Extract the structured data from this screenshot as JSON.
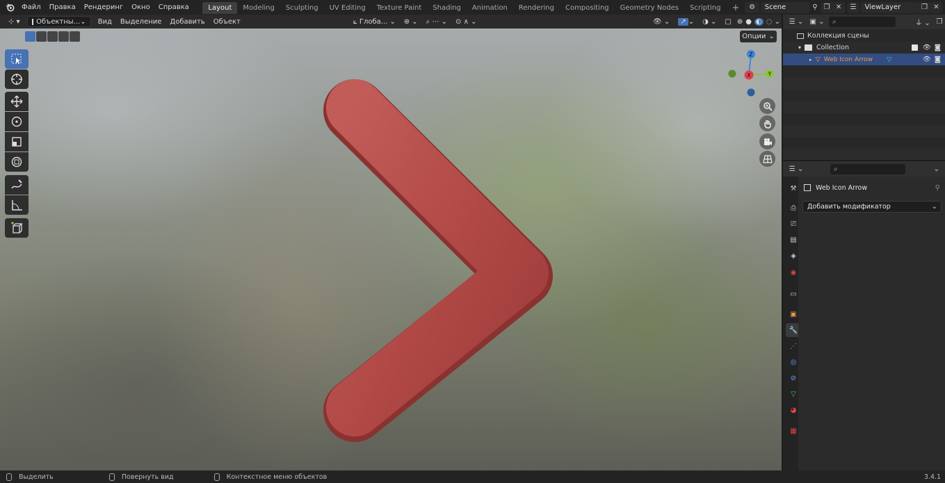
{
  "app": {
    "logo": "blender-logo-icon",
    "version": "3.4.1"
  },
  "menu": [
    "Файл",
    "Правка",
    "Рендеринг",
    "Окно",
    "Справка"
  ],
  "workspaces": [
    "Layout",
    "Modeling",
    "Sculpting",
    "UV Editing",
    "Texture Paint",
    "Shading",
    "Animation",
    "Rendering",
    "Compositing",
    "Geometry Nodes",
    "Scripting"
  ],
  "active_workspace": "Layout",
  "add_workspace": "+",
  "scene": {
    "name": "Scene",
    "view_layer": "ViewLayer"
  },
  "viewport_header": {
    "mode": "Объектны...",
    "menus": [
      "Вид",
      "Выделение",
      "Добавить",
      "Объект"
    ],
    "transform_orientation": "Глоба...",
    "options": "Опции"
  },
  "gizmo": {
    "axes": [
      "X",
      "Y",
      "Z"
    ]
  },
  "toolbar": [
    "select-box-icon",
    "cursor-icon",
    "move-icon",
    "rotate-icon",
    "scale-icon",
    "transform-icon",
    "annotate-icon",
    "measure-icon",
    "add-cube-icon"
  ],
  "navigation": [
    "zoom-icon",
    "pan-hand-icon",
    "camera-icon",
    "grid-perspective-icon"
  ],
  "object": {
    "shape": "chevron-right",
    "color": "#b24a47"
  },
  "outliner": {
    "scene_collection": "Коллекция сцены",
    "collection": "Collection",
    "object": "Web Icon Arrow"
  },
  "properties": {
    "object_name": "Web Icon Arrow",
    "add_modifier": "Добавить модификатор",
    "tabs": [
      "tool-icon",
      "render-icon",
      "output-icon",
      "view-layer-icon",
      "scene-icon",
      "world-icon",
      "collection-icon",
      "object-icon",
      "modifier-icon",
      "particles-icon",
      "physics-icon",
      "constraints-icon",
      "data-icon",
      "material-icon",
      "texture-icon"
    ]
  },
  "status": {
    "select": "Выделить",
    "rotate_view": "Повернуть вид",
    "context_menu": "Контекстное меню объектов"
  },
  "colors": {
    "accent": "#4772b3",
    "highlight_row": "#334d80",
    "object_text": "#e89a4a",
    "x_axis": "#e0404f",
    "y_axis": "#8bc43a",
    "z_axis": "#3f86d9"
  }
}
